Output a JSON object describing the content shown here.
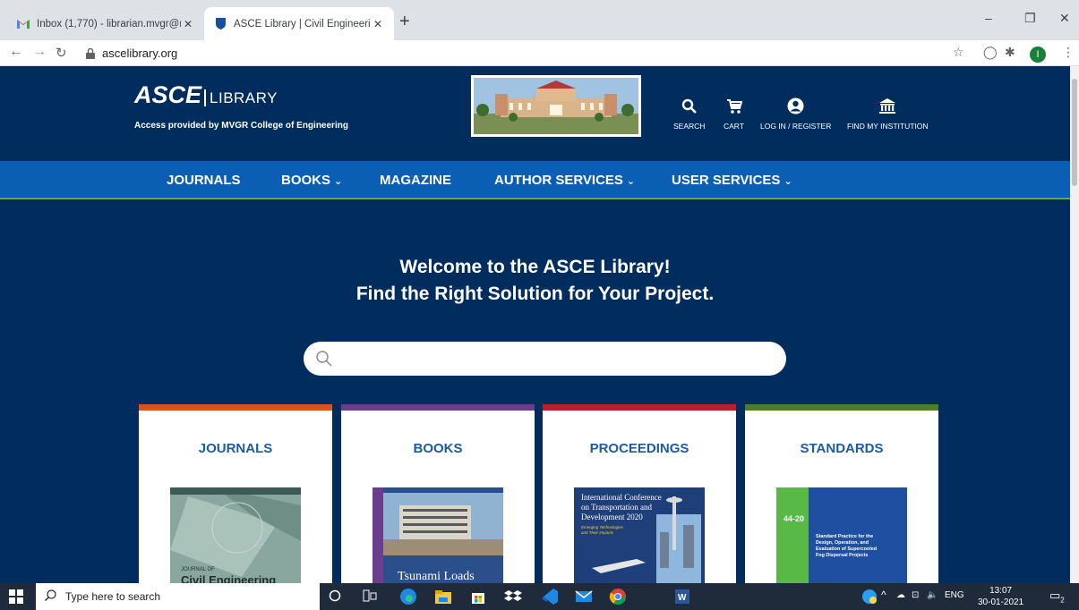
{
  "browser": {
    "tabs": [
      {
        "title": "Inbox (1,770) - librarian.mvgr@m",
        "favicon": "gmail-icon",
        "active": false
      },
      {
        "title": "ASCE Library | Civil Engineering a",
        "favicon": "asce-shield-icon",
        "active": true
      }
    ],
    "new_tab": "+",
    "url": "ascelibrary.org",
    "profile_initial": "I"
  },
  "site": {
    "logo": {
      "brand": "ASCE",
      "suffix": "LIBRARY",
      "access": "Access provided by MVGR College of Engineering"
    },
    "header_links": [
      {
        "label": "SEARCH",
        "icon": "search-icon"
      },
      {
        "label": "CART",
        "icon": "cart-icon"
      },
      {
        "label": "LOG IN / REGISTER",
        "icon": "user-icon"
      },
      {
        "label": "FIND MY INSTITUTION",
        "icon": "institution-icon"
      }
    ],
    "nav": [
      {
        "label": "JOURNALS",
        "dropdown": false
      },
      {
        "label": "BOOKS",
        "dropdown": true
      },
      {
        "label": "MAGAZINE",
        "dropdown": false
      },
      {
        "label": "AUTHOR SERVICES",
        "dropdown": true
      },
      {
        "label": "USER SERVICES",
        "dropdown": true
      }
    ],
    "welcome_line1": "Welcome to the ASCE Library!",
    "welcome_line2": "Find the Right Solution for Your Project.",
    "search_placeholder": "",
    "cards": [
      {
        "title": "JOURNALS",
        "accent": "#d9531e",
        "cover_text": "JOURNAL OF Civil Engineering"
      },
      {
        "title": "BOOKS",
        "accent": "#6a3d8f",
        "cover_text": "Tsunami Loads"
      },
      {
        "title": "PROCEEDINGS",
        "accent": "#b8202e",
        "cover_text": "International Conference on Transportation and Development 2020",
        "cover_subtext": "Emerging Technologies and Their Impacts"
      },
      {
        "title": "STANDARDS",
        "accent": "#4d7c2a",
        "cover_number": "44-20",
        "cover_text": "Standard Practice for the Design, Operation, and Evaluation of Supercooled Fog Dispersal Projects"
      }
    ]
  },
  "taskbar": {
    "search_placeholder": "Type here to search",
    "language": "ENG",
    "time": "13:07",
    "date": "30-01-2021",
    "notification_count": "2"
  },
  "colors": {
    "brand_navy": "#002d5d",
    "nav_blue": "#0a5eb3",
    "nav_underline": "#6aa834",
    "card_title": "#1e5b9c"
  }
}
